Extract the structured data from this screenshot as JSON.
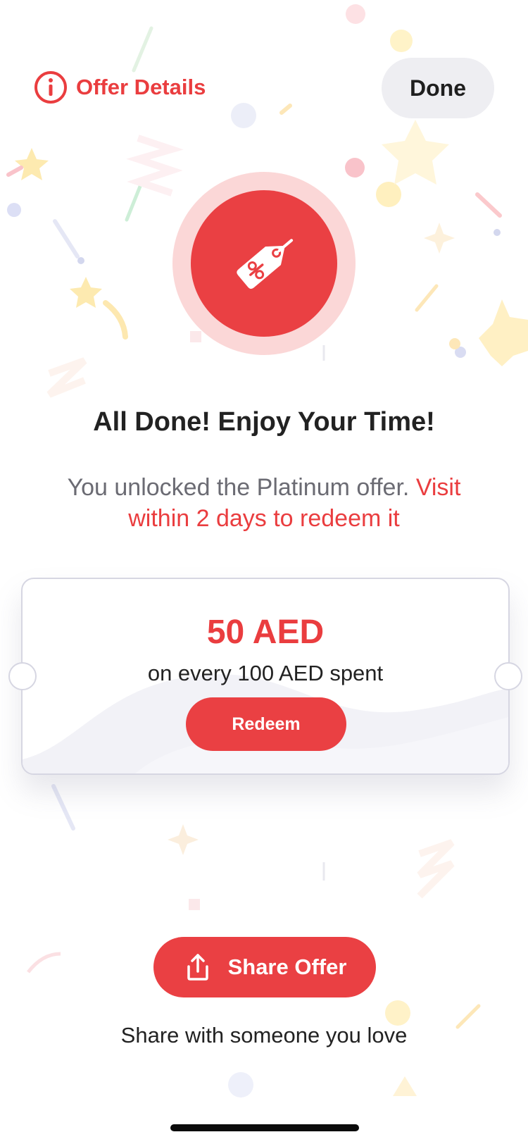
{
  "header": {
    "offer_details_label": "Offer Details",
    "done_label": "Done"
  },
  "message": {
    "headline": "All Done! Enjoy Your Time!",
    "body_plain": "You unlocked the Platinum offer.",
    "body_accent": "Visit within 2 days to redeem it"
  },
  "offer": {
    "amount": "50 AED",
    "condition": "on every 100 AED spent",
    "redeem_label": "Redeem"
  },
  "share": {
    "button_label": "Share Offer",
    "caption": "Share with someone you love"
  },
  "colors": {
    "accent": "#ea4043",
    "badge_halo": "#fbd7d7",
    "done_bg": "#eeeef2"
  },
  "icons": {
    "info": "info-circle-icon",
    "badge": "discount-tag-icon",
    "share": "share-upload-icon"
  }
}
